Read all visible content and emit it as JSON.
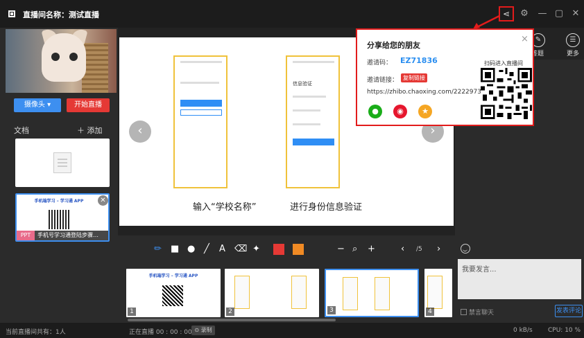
{
  "titlebar": {
    "title": "直播间名称：测试直播",
    "share_icon": "share-icon",
    "settings_icon": "gear-icon",
    "minimize": "—",
    "maximize": "▢",
    "close": "✕"
  },
  "left": {
    "camera_button": "摄像头 ▾",
    "start_live_button": "开始直播",
    "docs_label": "文档",
    "add_doc": "＋ 添加",
    "doc_ppt": {
      "badge": "PPT",
      "name": "手机号学习通登陆步骤…",
      "thumb_title": "手机端学习 – 学习通 APP"
    }
  },
  "stage": {
    "caption_left": "输入“学校名称”",
    "caption_right": "进行身份信息验证",
    "phone_right_title": "信息验证"
  },
  "right": {
    "q_label": "答题",
    "more_label": "更多",
    "chat_placeholder": "我要发言...",
    "mute_label": "禁言聊天",
    "send_button": "发表评论"
  },
  "toolbar": {
    "page_indicator": "/5",
    "prev": "‹",
    "next": "›",
    "zoom_out": "−",
    "zoom_in": "+",
    "colors": [
      "#e53935",
      "#f08a24"
    ]
  },
  "thumbs": [
    {
      "num": "1",
      "title": "手机端学习 – 学习通 APP"
    },
    {
      "num": "2",
      "title": ""
    },
    {
      "num": "3",
      "title": ""
    },
    {
      "num": "4",
      "title": ""
    }
  ],
  "status": {
    "online": "当前直播间共有：1人",
    "live": "正在直播 00 : 00 : 00",
    "record": "⊙ 录制",
    "net": "0 kB/s",
    "cpu": "CPU: 10 %"
  },
  "share_popup": {
    "title": "分享给您的朋友",
    "invite_code_label": "邀请码：",
    "invite_code": "EZ71836",
    "invite_link_label": "邀请链接：",
    "copy_link_button": "复制链接",
    "url": "https://zhibo.chaoxing.com/2222973",
    "scan_label": "扫码进入直播间",
    "close": "×",
    "social": [
      {
        "name": "wechat",
        "color": "#1aad19",
        "glyph": "●"
      },
      {
        "name": "weibo",
        "color": "#e6162d",
        "glyph": "◉"
      },
      {
        "name": "qzone",
        "color": "#f5a623",
        "glyph": "★"
      }
    ]
  }
}
